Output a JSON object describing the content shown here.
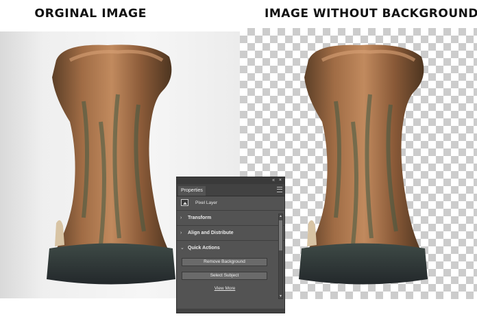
{
  "headings": {
    "left": "ORGINAL IMAGE",
    "right": "IMAGE WITHOUT BACKGROUND"
  },
  "panel": {
    "topbar": {
      "collapse_icon": "«",
      "close_icon": "×"
    },
    "tab_label": "Properties",
    "menu_icon": "panel-menu-icon",
    "layer_type": "Pixel Layer",
    "sections": [
      {
        "label": "Transform",
        "chevron": "›"
      },
      {
        "label": "Align and Distribute",
        "chevron": "›"
      },
      {
        "label": "Quick Actions",
        "chevron": "⌄"
      }
    ],
    "buttons": {
      "remove_background": "Remove Background",
      "select_subject": "Select Subject"
    },
    "view_more": "View More"
  },
  "colors": {
    "panel_bg": "#535353",
    "checker_dark": "#cccccc",
    "checker_light": "#ffffff"
  }
}
